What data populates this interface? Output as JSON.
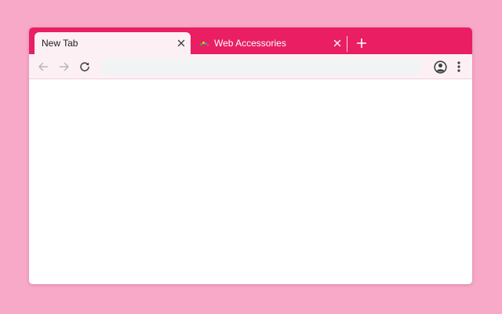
{
  "browser": {
    "tabs": [
      {
        "title": "New Tab",
        "active": true,
        "close_icon": "close-icon"
      },
      {
        "title": "Web Accessories",
        "active": false,
        "favicon": "web-accessories-favicon",
        "close_icon": "close-icon"
      }
    ],
    "new_tab_icon": "plus-icon",
    "toolbar": {
      "back_icon": "arrow-left-icon",
      "forward_icon": "arrow-right-icon",
      "reload_icon": "reload-icon",
      "address": {
        "value": "",
        "placeholder": ""
      },
      "profile_icon": "account-circle-icon",
      "menu_icon": "more-vertical-icon"
    }
  },
  "colors": {
    "page_background": "#f8a9c7",
    "frame": "#e91e63",
    "active_tab": "#fcf0f4",
    "toolbar": "#fcf0f4",
    "omnibox": "#f1f3f4",
    "content": "#ffffff",
    "tab_text_active": "#202124",
    "tab_text_inactive": "#ffffff"
  }
}
